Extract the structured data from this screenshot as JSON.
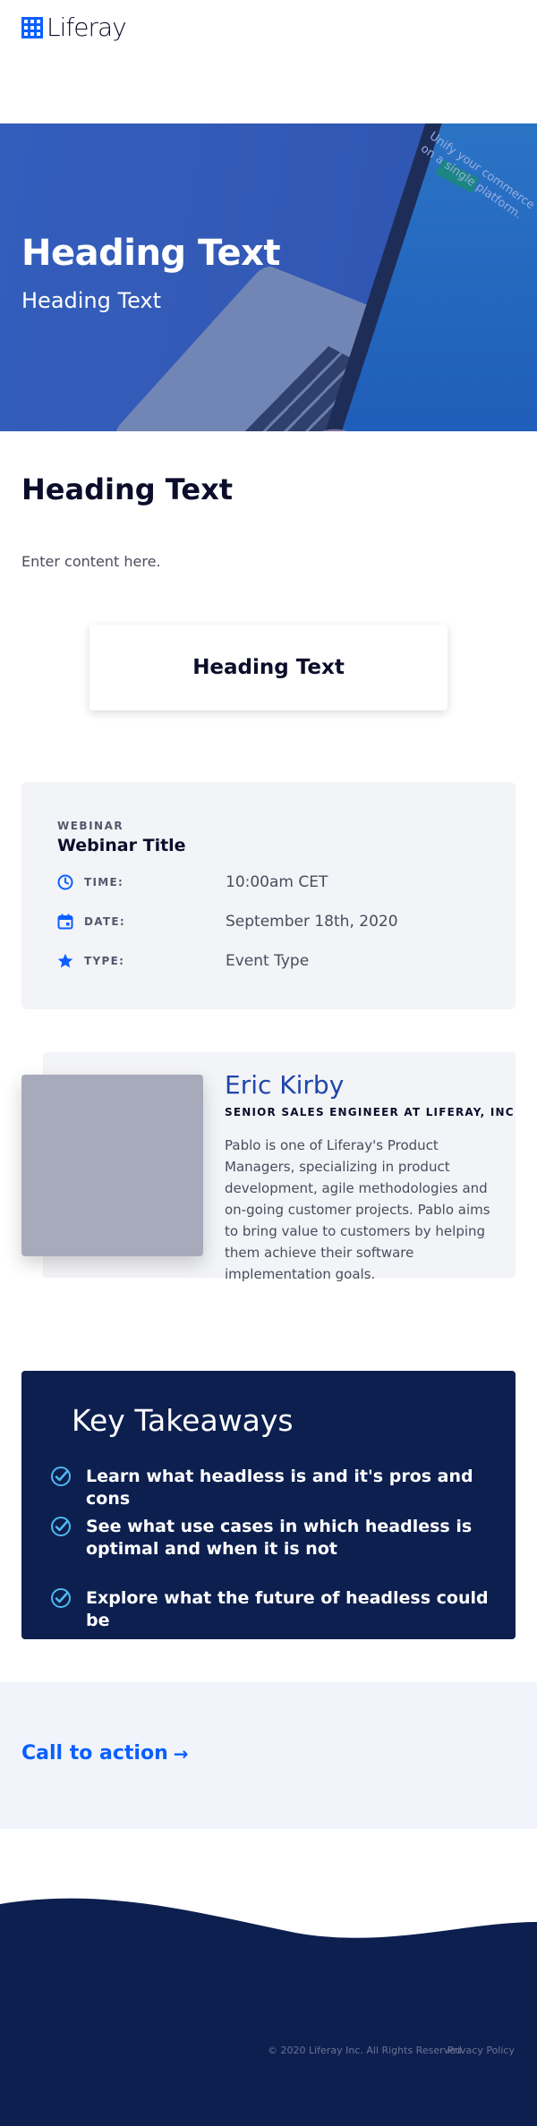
{
  "header": {
    "logo_text": "Liferay"
  },
  "hero": {
    "title": "Heading Text",
    "subtitle": "Heading Text",
    "screen_text": "Unify your commerce on a single platform."
  },
  "content": {
    "heading": "Heading Text",
    "body": "Enter content here."
  },
  "card": {
    "heading": "Heading Text"
  },
  "webinar": {
    "eyebrow": "WEBINAR",
    "title": "Webinar Title",
    "rows": [
      {
        "icon": "clock-icon",
        "label": "TIME:",
        "value": "10:00am CET"
      },
      {
        "icon": "calendar-icon",
        "label": "DATE:",
        "value": "September 18th, 2020"
      },
      {
        "icon": "star-icon",
        "label": "TYPE:",
        "value": "Event Type"
      }
    ]
  },
  "profile": {
    "name": "Eric Kirby",
    "role": "SENIOR SALES ENGINEER AT LIFERAY, INC",
    "bio": "Pablo is one of Liferay's Product Managers, specializing in product development, agile methodologies and on-going customer projects. Pablo aims to bring value to customers by helping them achieve their software implementation goals."
  },
  "takeaways": {
    "title": "Key Takeaways",
    "items": [
      "Learn what headless is and it's pros and cons",
      "See what use cases in which headless is optimal and when it is not",
      "Explore what the future of headless could be"
    ]
  },
  "cta": {
    "label": "Call to action",
    "arrow": "→"
  },
  "footer": {
    "copyright": "© 2020 Liferay Inc. All Rights Reserved",
    "privacy": "Privacy Policy"
  },
  "colors": {
    "brand": "#0b5fff",
    "navy": "#0c1f4f",
    "check": "#4fb7f0"
  }
}
